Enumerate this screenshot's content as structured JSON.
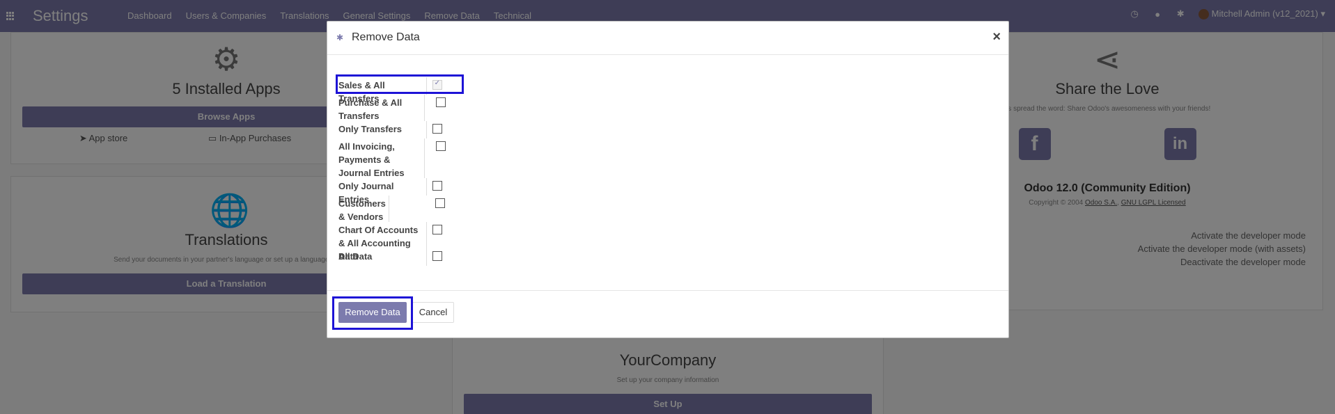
{
  "navbar": {
    "app_title": "Settings",
    "menu": [
      "Dashboard",
      "Users & Companies",
      "Translations",
      "General Settings",
      "Remove Data",
      "Technical"
    ],
    "user": "Mitchell Admin (v12_2021)"
  },
  "apps_card": {
    "title": "5 Installed Apps",
    "button": "Browse Apps",
    "link_store": "App store",
    "link_purchases": "In-App Purchases"
  },
  "translations_card": {
    "title": "Translations",
    "subtitle": "Send your documents in your partner's language or set up a language for",
    "button": "Load a Translation"
  },
  "company_card": {
    "title": "YourCompany",
    "subtitle": "Set up your company information",
    "button": "Set Up"
  },
  "share_card": {
    "title": "Share the Love",
    "subtitle": "us spread the word: Share Odoo's awesomeness with your friends!",
    "facebook_glyph": "f",
    "linkedin_glyph": "in"
  },
  "about": {
    "edition": "Odoo 12.0 (Community Edition)",
    "copyright_prefix": "Copyright © 2004",
    "company_link": "Odoo S.A.",
    "license_link": "GNU LGPL Licensed",
    "dev_links": [
      "Activate the developer mode",
      "Activate the developer mode (with assets)",
      "Deactivate the developer mode"
    ]
  },
  "modal": {
    "title": "Remove Data",
    "close": "×",
    "options": [
      {
        "label": "Sales & All Transfers",
        "checked": true
      },
      {
        "label": "Purchase & All Transfers",
        "checked": false
      },
      {
        "label": "Only Transfers",
        "checked": false
      },
      {
        "label": "All Invoicing, Payments & Journal Entries",
        "checked": false
      },
      {
        "label": "Only Journal Entries",
        "checked": false
      },
      {
        "label": "Customers & Vendors",
        "checked": false
      },
      {
        "label": "Chart Of Accounts & All Accounting Data",
        "checked": false
      },
      {
        "label": "All Data",
        "checked": false
      }
    ],
    "confirm_button": "Remove Data",
    "cancel_button": "Cancel"
  },
  "colors": {
    "brand": "#7c7bad",
    "highlight": "#1d13d6"
  }
}
